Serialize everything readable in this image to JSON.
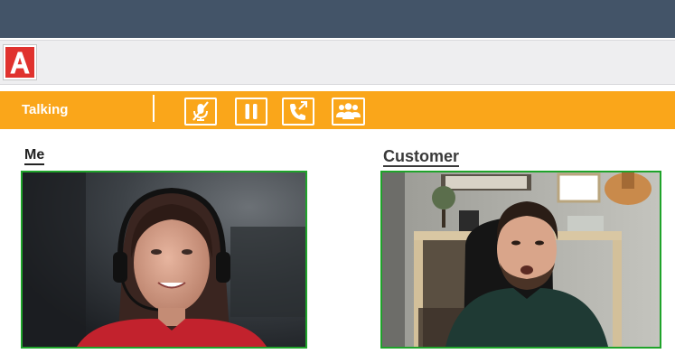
{
  "app": {
    "logo_letter": "A",
    "brand_color": "#e0322e"
  },
  "callbar": {
    "status": "Talking",
    "accent_color": "#faa61a",
    "controls": [
      {
        "name": "mute",
        "icon": "mic-off-icon"
      },
      {
        "name": "hold",
        "icon": "pause-icon"
      },
      {
        "name": "transfer",
        "icon": "phone-forward-icon"
      },
      {
        "name": "conference",
        "icon": "group-icon"
      }
    ]
  },
  "panels": {
    "me": {
      "label": "Me"
    },
    "customer": {
      "label": "Customer"
    }
  },
  "video_border_color": "#1fa32a"
}
